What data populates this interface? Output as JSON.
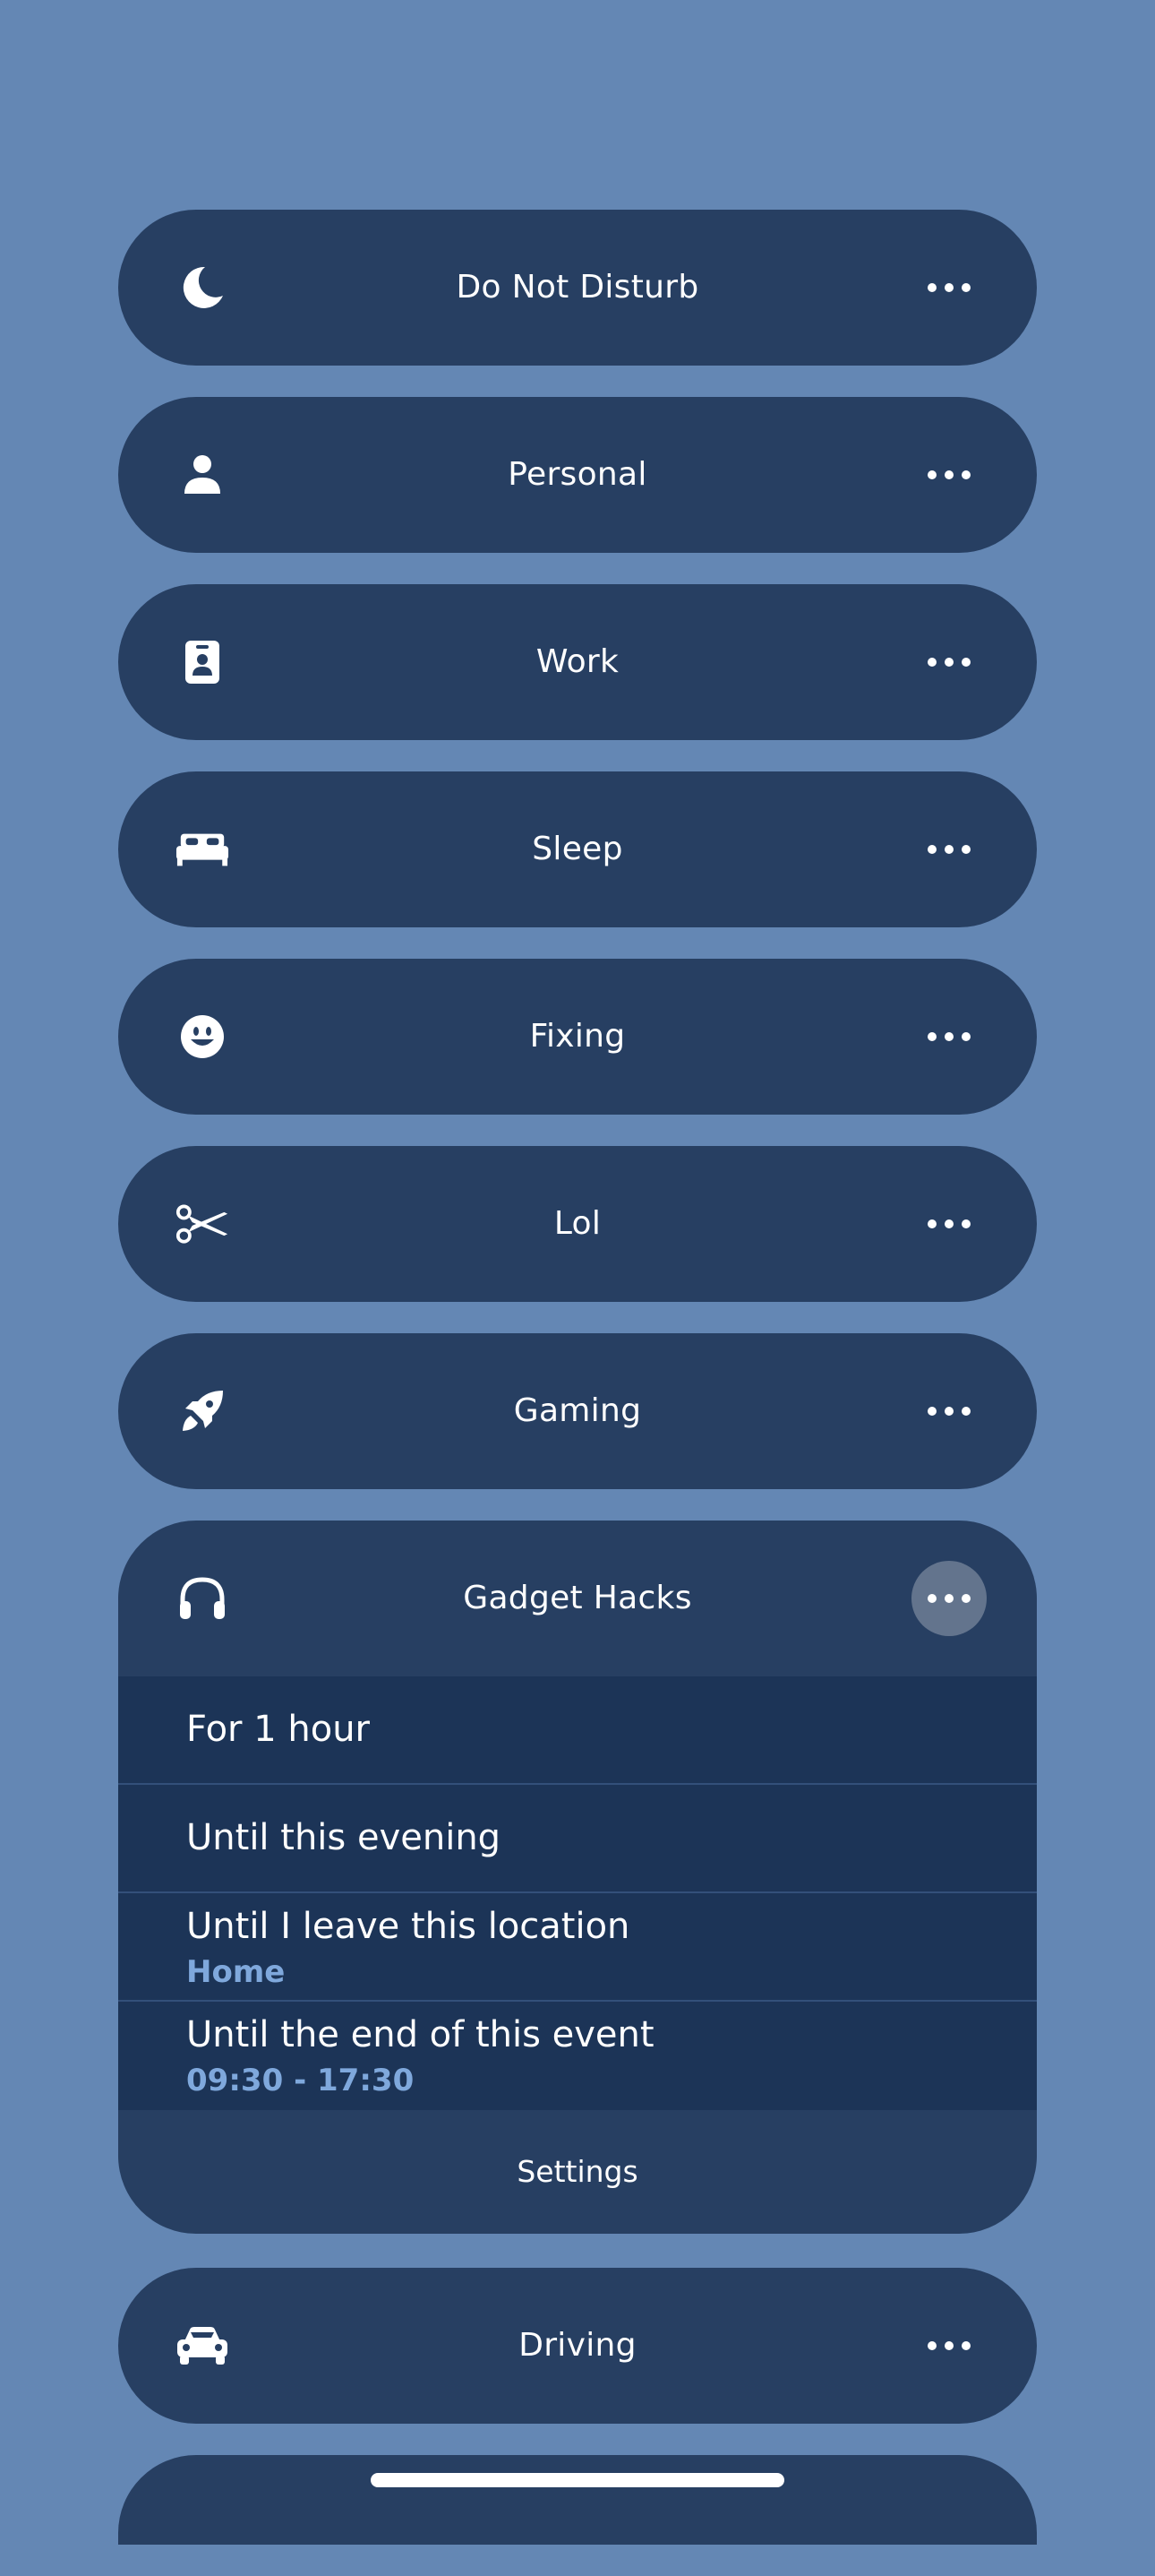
{
  "focus_modes": [
    {
      "label": "Do Not Disturb",
      "icon": "moon-icon"
    },
    {
      "label": "Personal",
      "icon": "person-icon"
    },
    {
      "label": "Work",
      "icon": "id-badge-icon"
    },
    {
      "label": "Sleep",
      "icon": "bed-icon"
    },
    {
      "label": "Fixing",
      "icon": "smiley-icon"
    },
    {
      "label": "Lol",
      "icon": "scissors-icon"
    },
    {
      "label": "Gaming",
      "icon": "rocket-icon"
    }
  ],
  "expanded_mode": {
    "label": "Gadget Hacks",
    "icon": "headphones-icon",
    "options": [
      {
        "title": "For 1 hour"
      },
      {
        "title": "Until this evening"
      },
      {
        "title": "Until I leave this location",
        "subtitle": "Home"
      },
      {
        "title": "Until the end of this event",
        "subtitle": "09:30 - 17:30"
      }
    ],
    "settings_label": "Settings"
  },
  "after_modes": [
    {
      "label": "Driving",
      "icon": "car-icon"
    }
  ],
  "colors": {
    "background": "#6487b4",
    "pill": "#273f62",
    "options_background": "#1c3457",
    "subtitle_accent": "#7fa8dc"
  }
}
